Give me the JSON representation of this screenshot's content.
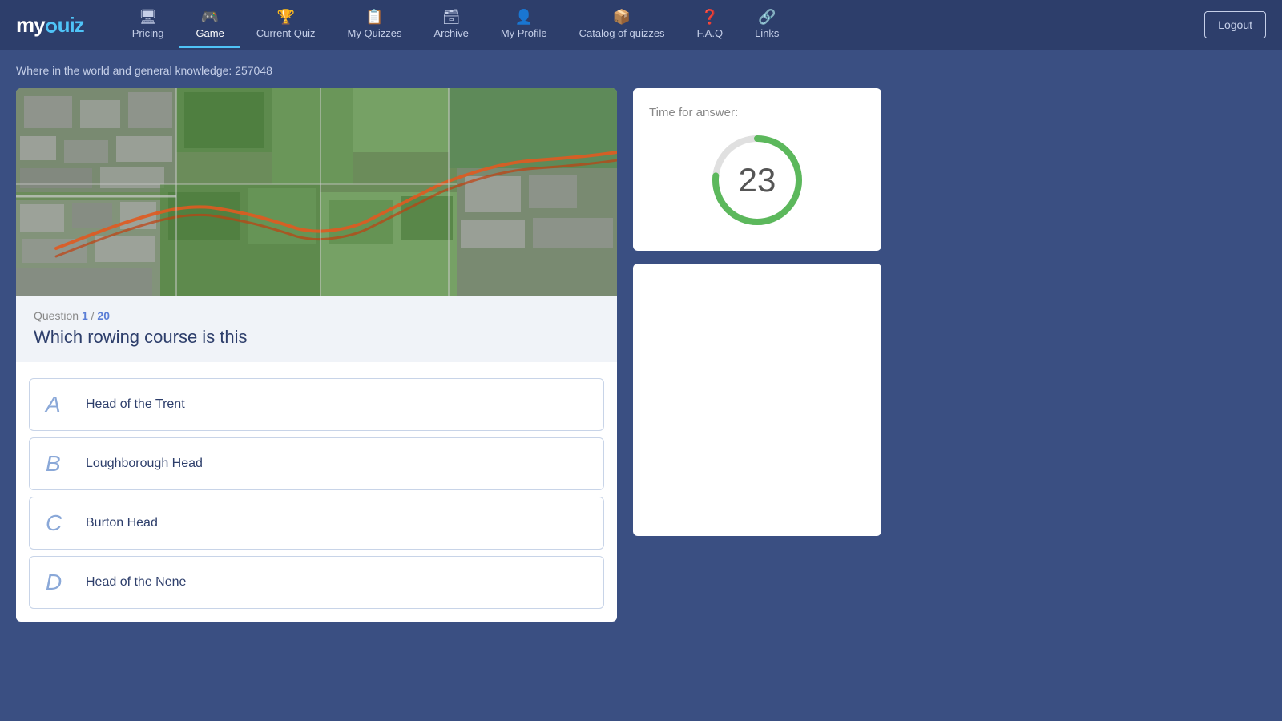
{
  "logo": {
    "prefix": "my",
    "suffix": "uiz"
  },
  "nav": {
    "items": [
      {
        "id": "pricing",
        "label": "Pricing",
        "icon": "🖥",
        "active": false
      },
      {
        "id": "game",
        "label": "Game",
        "icon": "🎮",
        "active": true
      },
      {
        "id": "current-quiz",
        "label": "Current Quiz",
        "icon": "🏆",
        "active": false
      },
      {
        "id": "my-quizzes",
        "label": "My Quizzes",
        "icon": "📋",
        "active": false
      },
      {
        "id": "archive",
        "label": "Archive",
        "icon": "🗃",
        "active": false
      },
      {
        "id": "my-profile",
        "label": "My Profile",
        "icon": "👤",
        "active": false
      },
      {
        "id": "catalog",
        "label": "Catalog of quizzes",
        "icon": "📦",
        "active": false
      },
      {
        "id": "faq",
        "label": "F.A.Q",
        "icon": "❓",
        "active": false
      },
      {
        "id": "links",
        "label": "Links",
        "icon": "🔗",
        "active": false
      }
    ],
    "logout_label": "Logout"
  },
  "breadcrumb": "Where in the world and general knowledge: 257048",
  "question": {
    "number": "1",
    "total": "20",
    "text": "Which rowing course is this"
  },
  "answers": [
    {
      "letter": "A",
      "text": "Head of the Trent"
    },
    {
      "letter": "B",
      "text": "Loughborough Head"
    },
    {
      "letter": "C",
      "text": "Burton Head"
    },
    {
      "letter": "D",
      "text": "Head of the Nene"
    }
  ],
  "timer": {
    "label": "Time for answer:",
    "value": "23",
    "max": 30,
    "current": 23,
    "color_active": "#5cb85c",
    "color_inactive": "#e0e0e0"
  }
}
